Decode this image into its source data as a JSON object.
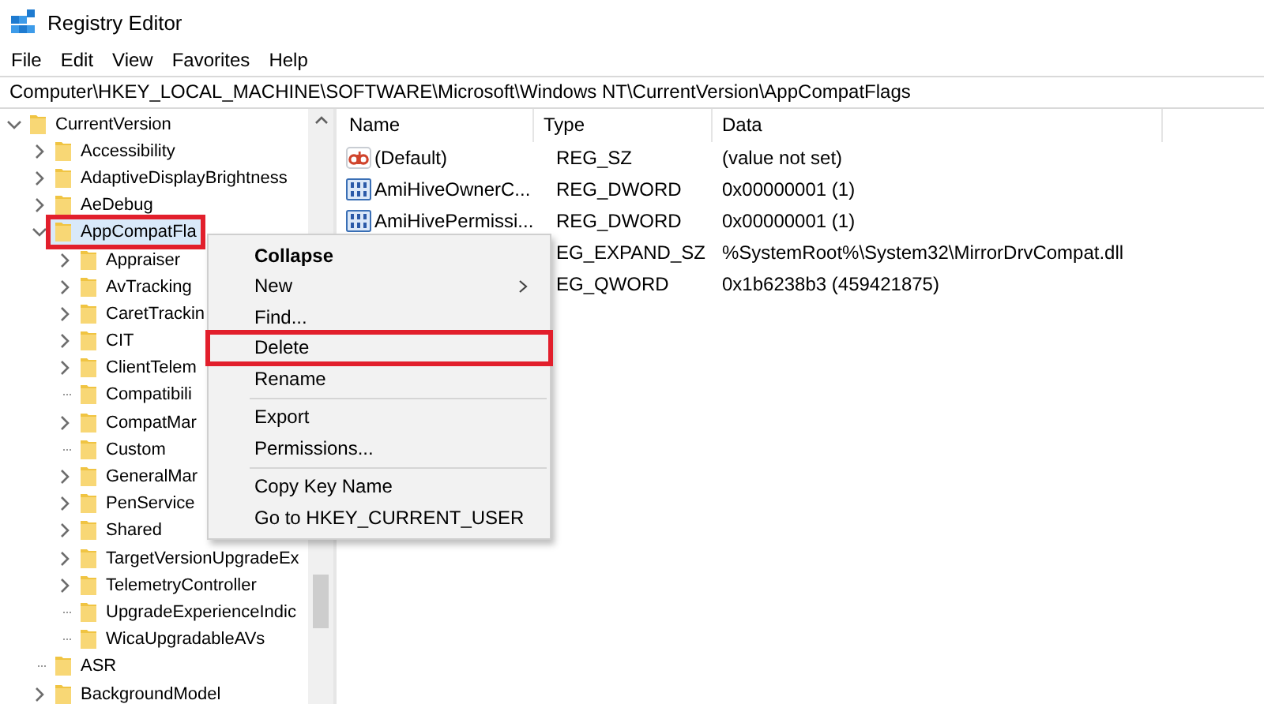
{
  "window": {
    "title": "Registry Editor"
  },
  "menu": [
    "File",
    "Edit",
    "View",
    "Favorites",
    "Help"
  ],
  "address": "Computer\\HKEY_LOCAL_MACHINE\\SOFTWARE\\Microsoft\\Windows NT\\CurrentVersion\\AppCompatFlags",
  "tree": {
    "items": [
      {
        "label": "CurrentVersion",
        "expandable": true,
        "expanded": true,
        "selected": false,
        "children": [
          {
            "label": "Accessibility",
            "expandable": true,
            "expanded": false,
            "selected": false
          },
          {
            "label": "AdaptiveDisplayBrightness",
            "expandable": true,
            "expanded": false,
            "selected": false
          },
          {
            "label": "AeDebug",
            "expandable": true,
            "expanded": false,
            "selected": false
          },
          {
            "label": "AppCompatFla",
            "expandable": true,
            "expanded": true,
            "selected": true,
            "annotated": true,
            "children": [
              {
                "label": "Appraiser",
                "expandable": true,
                "expanded": false,
                "selected": false
              },
              {
                "label": "AvTracking",
                "expandable": true,
                "expanded": false,
                "selected": false
              },
              {
                "label": "CaretTrackin",
                "expandable": true,
                "expanded": false,
                "selected": false
              },
              {
                "label": "CIT",
                "expandable": true,
                "expanded": false,
                "selected": false
              },
              {
                "label": "ClientTelem",
                "expandable": true,
                "expanded": false,
                "selected": false
              },
              {
                "label": "Compatibili",
                "expandable": false,
                "selected": false
              },
              {
                "label": "CompatMar",
                "expandable": true,
                "expanded": false,
                "selected": false
              },
              {
                "label": "Custom",
                "expandable": false,
                "selected": false
              },
              {
                "label": "GeneralMar",
                "expandable": true,
                "expanded": false,
                "selected": false
              },
              {
                "label": "PenService",
                "expandable": true,
                "expanded": false,
                "selected": false
              },
              {
                "label": "Shared",
                "expandable": true,
                "expanded": false,
                "selected": false
              },
              {
                "label": "TargetVersionUpgradeEx",
                "expandable": true,
                "expanded": false,
                "selected": false
              },
              {
                "label": "TelemetryController",
                "expandable": true,
                "expanded": false,
                "selected": false
              },
              {
                "label": "UpgradeExperienceIndic",
                "expandable": false,
                "selected": false
              },
              {
                "label": "WicaUpgradableAVs",
                "expandable": false,
                "selected": false
              }
            ]
          },
          {
            "label": "ASR",
            "expandable": false,
            "selected": false
          },
          {
            "label": "BackgroundModel",
            "expandable": true,
            "expanded": false,
            "selected": false
          }
        ]
      }
    ]
  },
  "values": {
    "columns": [
      "Name",
      "Type",
      "Data"
    ],
    "rows": [
      {
        "kind": "string",
        "name": "(Default)",
        "type": "REG_SZ",
        "data": "(value not set)"
      },
      {
        "kind": "binary",
        "name": "AmiHiveOwnerC...",
        "type": "REG_DWORD",
        "data": "0x00000001 (1)"
      },
      {
        "kind": "binary",
        "name": "AmiHivePermissi...",
        "type": "REG_DWORD",
        "data": "0x00000001 (1)"
      },
      {
        "type": "EG_EXPAND_SZ",
        "data": "%SystemRoot%\\System32\\MirrorDrvCompat.dll"
      },
      {
        "type": "EG_QWORD",
        "data": "0x1b6238b3 (459421875)"
      }
    ]
  },
  "context_menu": {
    "items": [
      {
        "kind": "item",
        "label": "Collapse",
        "default": true
      },
      {
        "kind": "item",
        "label": "New",
        "submenu": true
      },
      {
        "kind": "item",
        "label": "Find..."
      },
      {
        "kind": "item",
        "label": "Delete",
        "annotated": true
      },
      {
        "kind": "item",
        "label": "Rename"
      },
      {
        "kind": "separator"
      },
      {
        "kind": "item",
        "label": "Export"
      },
      {
        "kind": "item",
        "label": "Permissions..."
      },
      {
        "kind": "separator"
      },
      {
        "kind": "item",
        "label": "Copy Key Name"
      },
      {
        "kind": "item",
        "label": "Go to HKEY_CURRENT_USER"
      }
    ]
  }
}
